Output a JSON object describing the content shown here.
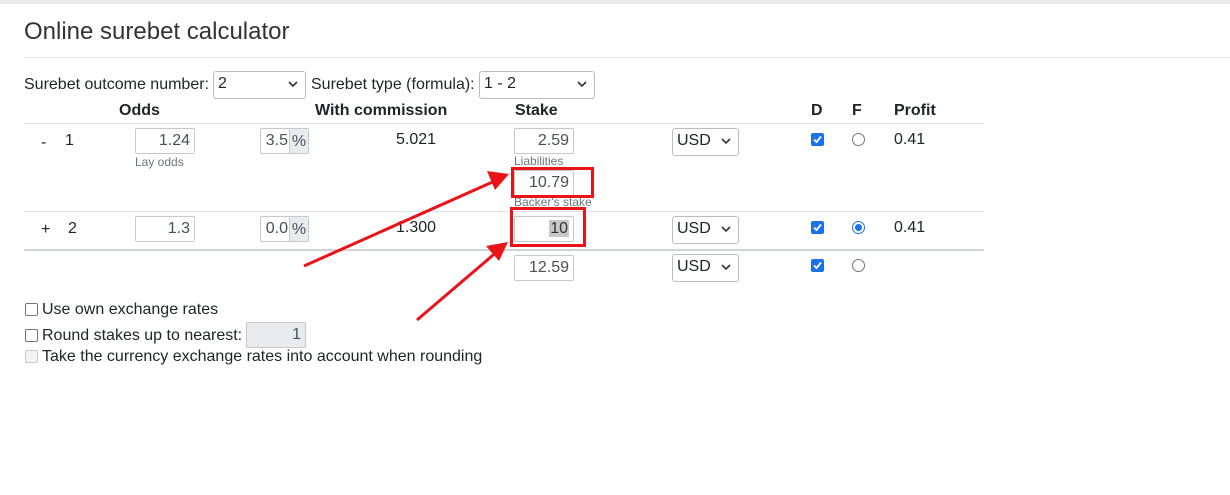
{
  "page": {
    "title": "Online surebet calculator"
  },
  "settings": {
    "outcome_label": "Surebet outcome number:",
    "outcome_value": "2",
    "type_label": "Surebet type (formula):",
    "type_value": "1 - 2"
  },
  "table": {
    "headers": {
      "odds": "Odds",
      "commission": "With commission",
      "stake": "Stake",
      "d": "D",
      "f": "F",
      "profit": "Profit"
    },
    "rows": [
      {
        "sign": "-",
        "number": "1",
        "odds": "1.24",
        "odds_note": "Lay odds",
        "commission_value": "3.5",
        "percent_sign": "%",
        "with_commission": "5.021",
        "stake": "2.59",
        "stake_note": "Liabilities",
        "extra_stake": "10.79",
        "extra_note": "Backer's stake",
        "currency": "USD",
        "d_checked": true,
        "f_checked": false,
        "profit": "0.41"
      },
      {
        "sign": "+",
        "number": "2",
        "odds": "1.3",
        "commission_value": "0.0",
        "percent_sign": "%",
        "with_commission": "1.300",
        "stake": "10",
        "currency": "USD",
        "d_checked": true,
        "f_checked": true,
        "profit": "0.41"
      }
    ],
    "total": {
      "stake": "12.59",
      "currency": "USD",
      "d_checked": true,
      "f_checked": false
    }
  },
  "options": {
    "own_rates_label": "Use own exchange rates",
    "round_label": "Round stakes up to nearest:",
    "round_value": "1",
    "rates_rounding_label": "Take the currency exchange rates into account when rounding"
  },
  "colors": {
    "annotation": "#e8141a",
    "checkbox_accent": "#1a73e8"
  }
}
